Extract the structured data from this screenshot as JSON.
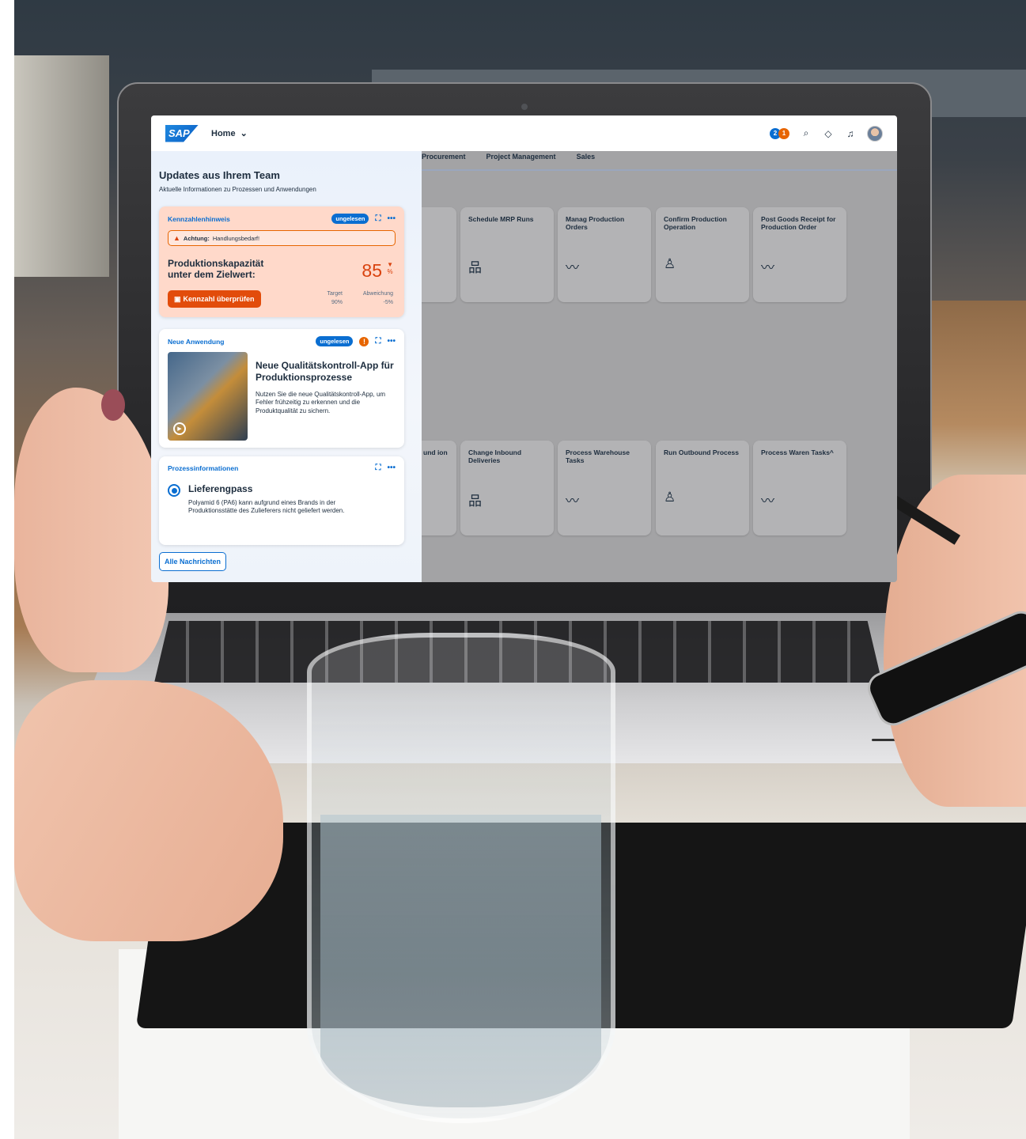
{
  "shellbar": {
    "logo": "SAP",
    "home_label": "Home",
    "notification_counts": [
      "2",
      "1"
    ]
  },
  "tabs": [
    "Procurement",
    "Project Management",
    "Sales"
  ],
  "tiles_row1": [
    {
      "title": "",
      "icon": "hierarchy-icon"
    },
    {
      "title": "Schedule MRP Runs",
      "icon": "hierarchy-icon"
    },
    {
      "title": "Manag Production Orders",
      "icon": "trend-icon"
    },
    {
      "title": "Confirm Production Operation",
      "icon": "person-list-icon"
    },
    {
      "title": "Post Goods Receipt for Production Order",
      "icon": "trend-icon"
    }
  ],
  "tiles_row2": [
    {
      "title": "und ion",
      "icon": ""
    },
    {
      "title": "Change Inbound Deliveries",
      "icon": "hierarchy-icon"
    },
    {
      "title": "Process Warehouse Tasks",
      "icon": "trend-icon"
    },
    {
      "title": "Run Outbound Process",
      "icon": "person-list-icon"
    },
    {
      "title": "Process Waren Tasks^",
      "icon": "trend-icon"
    }
  ],
  "panel": {
    "title": "Updates aus Ihrem Team",
    "subtitle": "Aktuelle Informationen zu Prozessen und Anwendungen",
    "kpi_card": {
      "label": "Kennzahlenhinweis",
      "badge": "ungelesen",
      "warning_prefix": "Achtung:",
      "warning_text": "Handlungsbedarf!",
      "kpi_text": "Produktionskapazität unter dem Zielwert:",
      "value": "85",
      "unit": "%",
      "button": "Kennzahl überprüfen",
      "target_label": "Target",
      "target_value": "90%",
      "deviation_label": "Abweichung",
      "deviation_value": "-5%"
    },
    "app_card": {
      "label": "Neue Anwendung",
      "badge": "ungelesen",
      "title": "Neue Qualitätskontroll-App für Produktionsprozesse",
      "description": "Nutzen Sie die neue Qualitätskontroll-App, um Fehler frühzeitig zu erkennen und die Produktqualität zu sichern."
    },
    "process_card": {
      "label": "Prozessinformationen",
      "title": "Lieferengpass",
      "description": "Polyamid 6 (PA6) kann aufgrund eines Brands in der Produktionsstätte des Zulieferers nicht geliefert werden."
    },
    "all_button": "Alle Nachrichten"
  },
  "colors": {
    "accent": "#0a6ed1",
    "warning": "#e76500",
    "critical": "#d9430f"
  }
}
